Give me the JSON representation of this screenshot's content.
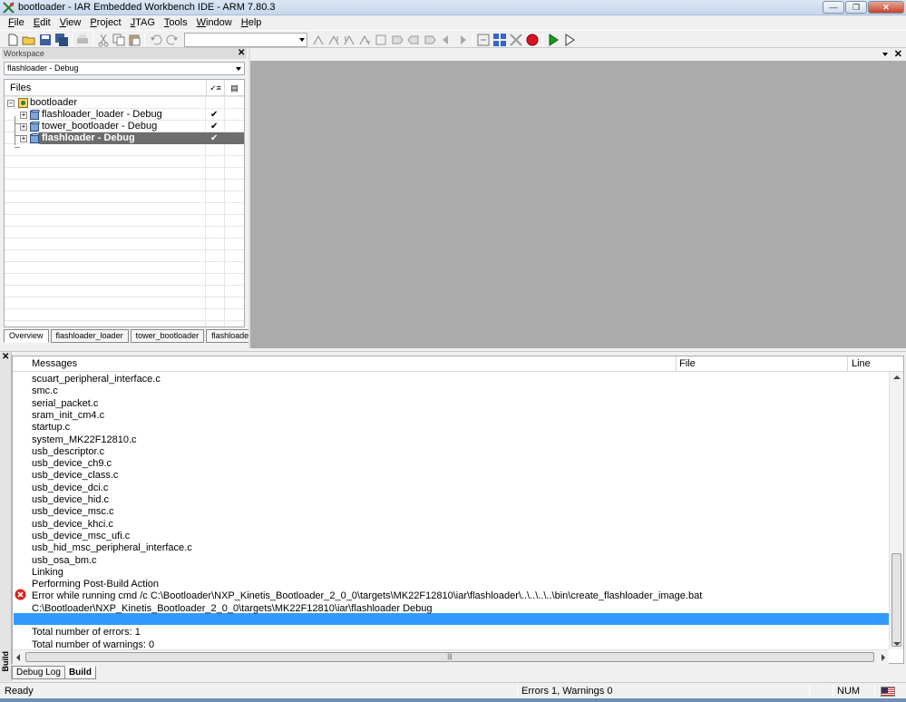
{
  "window": {
    "title": "bootloader - IAR Embedded Workbench IDE - ARM 7.80.3"
  },
  "menu": {
    "items": [
      {
        "label": "File",
        "key": "F",
        "rest": "ile"
      },
      {
        "label": "Edit",
        "key": "E",
        "rest": "dit"
      },
      {
        "label": "View",
        "key": "V",
        "rest": "iew"
      },
      {
        "label": "Project",
        "key": "P",
        "rest": "roject"
      },
      {
        "label": "JTAG",
        "key": "J",
        "rest": "TAG"
      },
      {
        "label": "Tools",
        "key": "T",
        "rest": "ools"
      },
      {
        "label": "Window",
        "key": "W",
        "rest": "indow"
      },
      {
        "label": "Help",
        "key": "H",
        "rest": "elp"
      }
    ]
  },
  "toolbar": {
    "search_value": ""
  },
  "workspace": {
    "panel_title": "Workspace",
    "config_selected": "flashloader - Debug",
    "files_header": "Files",
    "tree": [
      {
        "label": "bootloader",
        "checked": false
      },
      {
        "label": "flashloader_loader - Debug",
        "checked": true
      },
      {
        "label": "tower_bootloader - Debug",
        "checked": true
      },
      {
        "label": "flashloader - Debug",
        "checked": true
      }
    ],
    "check_glyph": "✔",
    "tabs": [
      "Overview",
      "flashloader_loader",
      "tower_bootloader",
      "flashloader"
    ]
  },
  "build": {
    "side_label": "Build",
    "columns": {
      "messages": "Messages",
      "file": "File",
      "line": "Line"
    },
    "messages": [
      "scuart_peripheral_interface.c",
      "smc.c",
      "serial_packet.c",
      "sram_init_cm4.c",
      "startup.c",
      "system_MK22F12810.c",
      "usb_descriptor.c",
      "usb_device_ch9.c",
      "usb_device_class.c",
      "usb_device_dci.c",
      "usb_device_hid.c",
      "usb_device_msc.c",
      "usb_device_khci.c",
      "usb_device_msc_ufi.c",
      "usb_hid_msc_peripheral_interface.c",
      "usb_osa_bm.c",
      "Linking",
      "Performing Post-Build Action",
      "Error while running cmd /c C:\\Bootloader\\NXP_Kinetis_Bootloader_2_0_0\\targets\\MK22F12810\\iar\\flashloader\\..\\..\\..\\..\\bin\\create_flashloader_image.bat",
      "C:\\Bootloader\\NXP_Kinetis_Bootloader_2_0_0\\targets\\MK22F12810\\iar\\flashloader Debug",
      "",
      "Total number of errors: 1",
      "Total number of warnings: 0"
    ],
    "tabs": [
      "Debug Log",
      "Build"
    ]
  },
  "status": {
    "ready": "Ready",
    "errors": "Errors 1, Warnings 0",
    "num": "NUM"
  }
}
